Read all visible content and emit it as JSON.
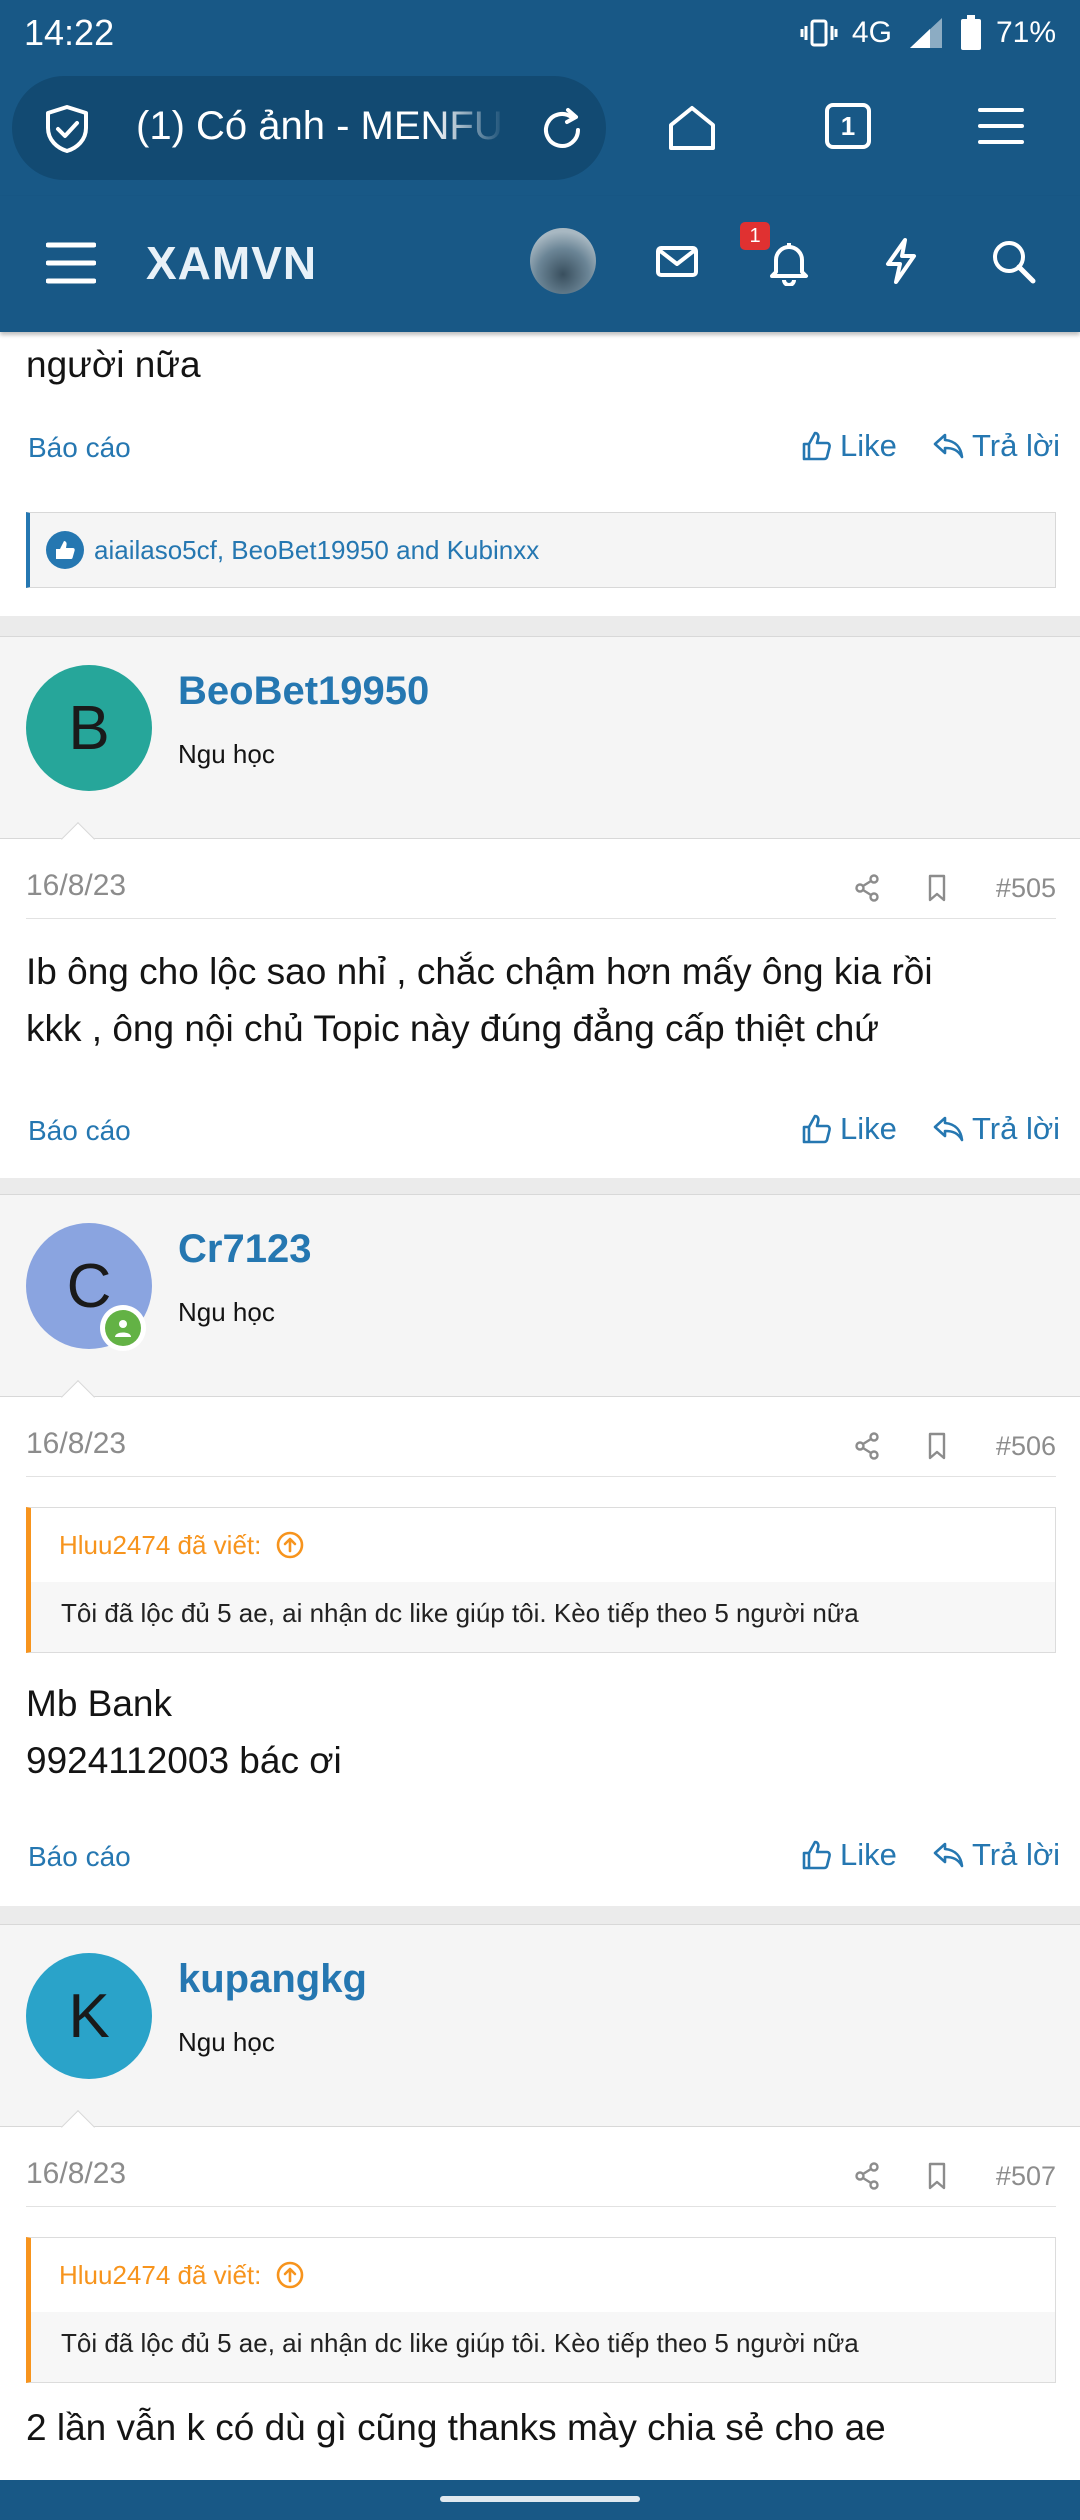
{
  "status_bar": {
    "time": "14:22",
    "network": "4G",
    "battery": "71%"
  },
  "browser": {
    "page_title": "(1) Có ảnh - MENFU",
    "tab_count": "1"
  },
  "site": {
    "logo": "XAMVN",
    "notification_count": "1"
  },
  "colors": {
    "brand": "#185886",
    "link": "#2577b1",
    "quote_accent": "#f7941d",
    "online": "#63b245"
  },
  "icons": [
    "shield-check-icon",
    "reload-icon",
    "home-icon",
    "tabs-icon",
    "menu-icon",
    "hamburger-icon",
    "mail-icon",
    "bell-icon",
    "bolt-icon",
    "search-icon",
    "share-icon",
    "bookmark-icon",
    "thumbs-up-icon",
    "reply-icon",
    "arrow-up-circle-icon"
  ],
  "previous_post": {
    "tail_text": "người nữa",
    "report_label": "Báo cáo",
    "like_label": "Like",
    "reply_label": "Trả lời",
    "reactions": "aiailaso5cf, BeoBet19950 and Kubinxx"
  },
  "posts": [
    {
      "avatar_letter": "B",
      "avatar_color": "#26a69a",
      "username": "BeoBet19950",
      "user_title": "Ngu học",
      "date": "16/8/23",
      "number": "#505",
      "body_lines": [
        "Ib ông cho lộc sao nhỉ , chắc chậm hơn mấy ông kia rồi",
        "kkk , ông nội chủ Topic này đúng đẳng cấp thiệt chứ"
      ],
      "report_label": "Báo cáo",
      "like_label": "Like",
      "reply_label": "Trả lời"
    },
    {
      "avatar_letter": "C",
      "avatar_color": "#8aa4e0",
      "username": "Cr7123",
      "user_title": "Ngu học",
      "date": "16/8/23",
      "number": "#506",
      "quote_author": "Hluu2474 đã viết:",
      "quote_text": "Tôi đã lộc đủ 5 ae, ai nhận dc like giúp tôi. Kèo tiếp theo 5 người nữa",
      "body_lines": [
        "Mb Bank",
        "9924112003 bác ơi"
      ],
      "report_label": "Báo cáo",
      "like_label": "Like",
      "reply_label": "Trả lời"
    },
    {
      "avatar_letter": "K",
      "avatar_color": "#2aa3c9",
      "username": "kupangkg",
      "user_title": "Ngu học",
      "date": "16/8/23",
      "number": "#507",
      "quote_author": "Hluu2474 đã viết:",
      "quote_text": "Tôi đã lộc đủ 5 ae, ai nhận dc like giúp tôi. Kèo tiếp theo 5 người nữa",
      "body_lines": [
        "2 lần vẫn k có dù gì cũng thanks mày chia sẻ cho ae"
      ]
    }
  ]
}
